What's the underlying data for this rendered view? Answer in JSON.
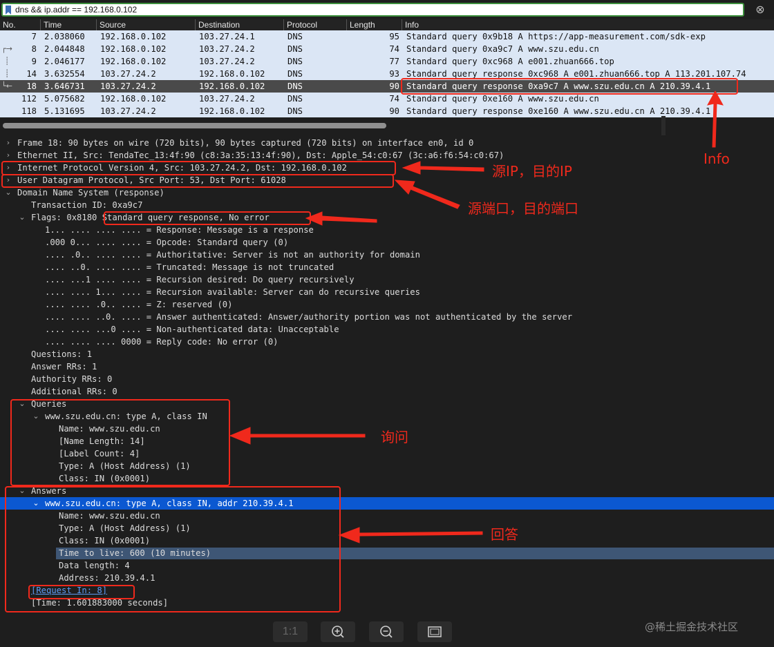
{
  "filter": {
    "value": "dns && ip.addr == 192.168.0.102",
    "bookmark_icon": "bookmark-icon",
    "clear_icon": "close-circle-icon"
  },
  "packet_list": {
    "columns": [
      "No.",
      "Time",
      "Source",
      "Destination",
      "Protocol",
      "Length",
      "Info"
    ],
    "rows": [
      {
        "no": "7",
        "time": "2.038060",
        "src": "192.168.0.102",
        "dst": "103.27.24.1",
        "proto": "DNS",
        "len": "95",
        "info": "Standard query 0x9b18 A https://app-measurement.com/sdk-exp",
        "rel": ""
      },
      {
        "no": "8",
        "time": "2.044848",
        "src": "192.168.0.102",
        "dst": "103.27.24.2",
        "proto": "DNS",
        "len": "74",
        "info": "Standard query 0xa9c7 A www.szu.edu.cn",
        "rel": "┌→"
      },
      {
        "no": "9",
        "time": "2.046177",
        "src": "192.168.0.102",
        "dst": "103.27.24.2",
        "proto": "DNS",
        "len": "77",
        "info": "Standard query 0xc968 A e001.zhuan666.top",
        "rel": "┊"
      },
      {
        "no": "14",
        "time": "3.632554",
        "src": "103.27.24.2",
        "dst": "192.168.0.102",
        "proto": "DNS",
        "len": "93",
        "info": "Standard query response 0xc968 A e001.zhuan666.top A 113.201.107.74",
        "rel": "┊"
      },
      {
        "no": "18",
        "time": "3.646731",
        "src": "103.27.24.2",
        "dst": "192.168.0.102",
        "proto": "DNS",
        "len": "90",
        "info": "Standard query response 0xa9c7 A www.szu.edu.cn A 210.39.4.1",
        "rel": "└←"
      },
      {
        "no": "112",
        "time": "5.075682",
        "src": "192.168.0.102",
        "dst": "103.27.24.2",
        "proto": "DNS",
        "len": "74",
        "info": "Standard query 0xe160 A www.szu.edu.cn",
        "rel": ""
      },
      {
        "no": "118",
        "time": "5.131695",
        "src": "103.27.24.2",
        "dst": "192.168.0.102",
        "proto": "DNS",
        "len": "90",
        "info": "Standard query response 0xe160 A www.szu.edu.cn A 210.39.4.1",
        "rel": ""
      }
    ],
    "selected_no": "18"
  },
  "tree": [
    {
      "indent": 0,
      "arrow": "›",
      "text": "Frame 18: 90 bytes on wire (720 bits), 90 bytes captured (720 bits) on interface en0, id 0"
    },
    {
      "indent": 0,
      "arrow": "›",
      "text": "Ethernet II, Src: TendaTec_13:4f:90 (c8:3a:35:13:4f:90), Dst: Apple_54:c0:67 (3c:a6:f6:54:c0:67)"
    },
    {
      "indent": 0,
      "arrow": "›",
      "text": "Internet Protocol Version 4, Src: 103.27.24.2, Dst: 192.168.0.102"
    },
    {
      "indent": 0,
      "arrow": "›",
      "text": "User Datagram Protocol, Src Port: 53, Dst Port: 61028"
    },
    {
      "indent": 0,
      "arrow": "⌄",
      "text": "Domain Name System (response)"
    },
    {
      "indent": 1,
      "arrow": "",
      "text": "Transaction ID: 0xa9c7"
    },
    {
      "indent": 1,
      "arrow": "⌄",
      "text": "Flags: 0x8180 Standard query response, No error"
    },
    {
      "indent": 2,
      "arrow": "",
      "text": "1... .... .... .... = Response: Message is a response"
    },
    {
      "indent": 2,
      "arrow": "",
      "text": ".000 0... .... .... = Opcode: Standard query (0)"
    },
    {
      "indent": 2,
      "arrow": "",
      "text": ".... .0.. .... .... = Authoritative: Server is not an authority for domain"
    },
    {
      "indent": 2,
      "arrow": "",
      "text": ".... ..0. .... .... = Truncated: Message is not truncated"
    },
    {
      "indent": 2,
      "arrow": "",
      "text": ".... ...1 .... .... = Recursion desired: Do query recursively"
    },
    {
      "indent": 2,
      "arrow": "",
      "text": ".... .... 1... .... = Recursion available: Server can do recursive queries"
    },
    {
      "indent": 2,
      "arrow": "",
      "text": ".... .... .0.. .... = Z: reserved (0)"
    },
    {
      "indent": 2,
      "arrow": "",
      "text": ".... .... ..0. .... = Answer authenticated: Answer/authority portion was not authenticated by the server"
    },
    {
      "indent": 2,
      "arrow": "",
      "text": ".... .... ...0 .... = Non-authenticated data: Unacceptable"
    },
    {
      "indent": 2,
      "arrow": "",
      "text": ".... .... .... 0000 = Reply code: No error (0)"
    },
    {
      "indent": 1,
      "arrow": "",
      "text": "Questions: 1"
    },
    {
      "indent": 1,
      "arrow": "",
      "text": "Answer RRs: 1"
    },
    {
      "indent": 1,
      "arrow": "",
      "text": "Authority RRs: 0"
    },
    {
      "indent": 1,
      "arrow": "",
      "text": "Additional RRs: 0"
    },
    {
      "indent": 1,
      "arrow": "⌄",
      "text": "Queries"
    },
    {
      "indent": 2,
      "arrow": "⌄",
      "text": "www.szu.edu.cn: type A, class IN"
    },
    {
      "indent": 3,
      "arrow": "",
      "text": "Name: www.szu.edu.cn"
    },
    {
      "indent": 3,
      "arrow": "",
      "text": "[Name Length: 14]"
    },
    {
      "indent": 3,
      "arrow": "",
      "text": "[Label Count: 4]"
    },
    {
      "indent": 3,
      "arrow": "",
      "text": "Type: A (Host Address) (1)"
    },
    {
      "indent": 3,
      "arrow": "",
      "text": "Class: IN (0x0001)"
    },
    {
      "indent": 1,
      "arrow": "⌄",
      "text": "Answers"
    },
    {
      "indent": 2,
      "arrow": "⌄",
      "text": "www.szu.edu.cn: type A, class IN, addr 210.39.4.1",
      "selected": true
    },
    {
      "indent": 3,
      "arrow": "",
      "text": "Name: www.szu.edu.cn"
    },
    {
      "indent": 3,
      "arrow": "",
      "text": "Type: A (Host Address) (1)"
    },
    {
      "indent": 3,
      "arrow": "",
      "text": "Class: IN (0x0001)"
    },
    {
      "indent": 3,
      "arrow": "",
      "text": "Time to live: 600 (10 minutes)",
      "highlight": true
    },
    {
      "indent": 3,
      "arrow": "",
      "text": "Data length: 4"
    },
    {
      "indent": 3,
      "arrow": "",
      "text": "Address: 210.39.4.1"
    },
    {
      "indent": 1,
      "arrow": "",
      "text": "[Request In: 8]",
      "link": true
    },
    {
      "indent": 1,
      "arrow": "",
      "text": "[Time: 1.601883000 seconds]"
    }
  ],
  "annotations": {
    "info": "Info",
    "ip": "源IP，目的IP",
    "port": "源端口，目的端口",
    "query": "询问",
    "answer": "回答"
  },
  "toolbar": {
    "actual_size": "1:1",
    "zoom_in_icon": "zoom-in-icon",
    "zoom_out_icon": "zoom-out-icon",
    "fit_icon": "fit-screen-icon"
  },
  "watermark": "@稀土掘金技术社区",
  "colors": {
    "annotation": "#f0291c",
    "selection_blue": "#0b58d1",
    "filter_border": "#3d8f3d",
    "packet_bg": "#dbe6f5"
  }
}
